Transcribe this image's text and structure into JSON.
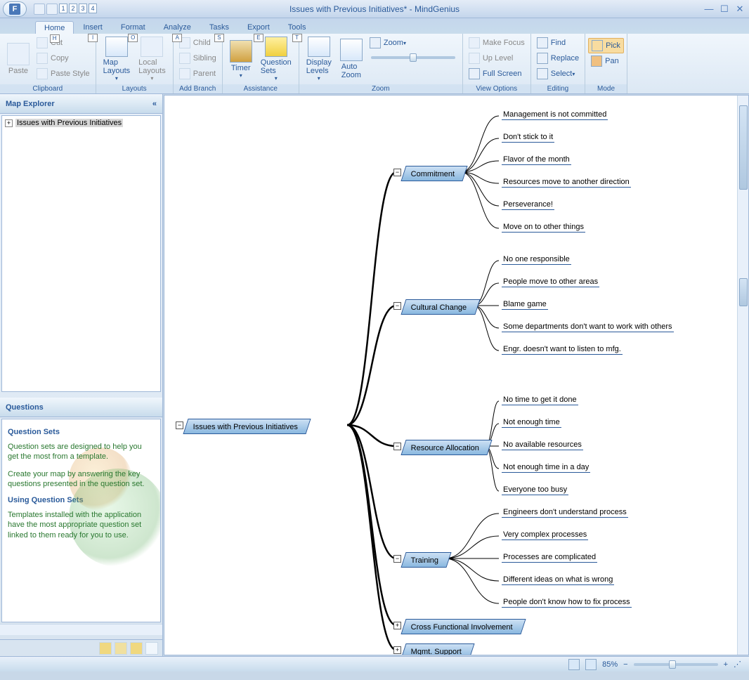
{
  "window": {
    "title": "Issues with Previous Initiatives* - MindGenius",
    "app_letter": "F"
  },
  "qat": {
    "nums": [
      "1",
      "2",
      "3",
      "4"
    ]
  },
  "tabs": [
    {
      "label": "Home",
      "key": "H",
      "active": true
    },
    {
      "label": "Insert",
      "key": "I",
      "active": false
    },
    {
      "label": "Format",
      "key": "O",
      "active": false
    },
    {
      "label": "Analyze",
      "key": "A",
      "active": false
    },
    {
      "label": "Tasks",
      "key": "S",
      "active": false
    },
    {
      "label": "Export",
      "key": "E",
      "active": false
    },
    {
      "label": "Tools",
      "key": "T",
      "active": false
    }
  ],
  "ribbon": {
    "clipboard": {
      "label": "Clipboard",
      "paste": "Paste",
      "cut": "Cut",
      "copy": "Copy",
      "paste_style": "Paste Style"
    },
    "layouts": {
      "label": "Layouts",
      "map": "Map\nLayouts",
      "local": "Local\nLayouts"
    },
    "addbranch": {
      "label": "Add Branch",
      "child": "Child",
      "sibling": "Sibling",
      "parent": "Parent"
    },
    "assistance": {
      "label": "Assistance",
      "timer": "Timer",
      "qsets": "Question\nSets"
    },
    "zoom": {
      "label": "Zoom",
      "levels": "Display\nLevels",
      "auto": "Auto\nZoom",
      "zoom": "Zoom"
    },
    "viewopts": {
      "label": "View Options",
      "focus": "Make Focus",
      "up": "Up Level",
      "full": "Full Screen"
    },
    "editing": {
      "label": "Editing",
      "find": "Find",
      "replace": "Replace",
      "select": "Select"
    },
    "mode": {
      "label": "Mode",
      "pick": "Pick",
      "pan": "Pan"
    }
  },
  "explorer": {
    "title": "Map Explorer",
    "root": "Issues with Previous Initiatives"
  },
  "questions": {
    "title": "Questions",
    "h1": "Question Sets",
    "p1": "Question sets are designed to help you get the most from a template.",
    "p2": "Create your map by answering the key questions presented in the question set.",
    "h2": "Using Question Sets",
    "p3": "Templates installed with the application have the most appropriate question set linked to them ready for you to use."
  },
  "map": {
    "root": "Issues with Previous Initiatives",
    "branches": [
      {
        "label": "Commitment",
        "leaves": [
          "Management is not committed",
          "Don't stick to it",
          "Flavor of the month",
          "Resources move to another direction",
          "Perseverance!",
          "Move on to other things"
        ]
      },
      {
        "label": "Cultural Change",
        "leaves": [
          "No one responsible",
          "People move to other areas",
          "Blame game",
          "Some departments don't want to work with others",
          "Engr. doesn't want to listen to mfg."
        ]
      },
      {
        "label": "Resource Allocation",
        "leaves": [
          "No time to get it done",
          "Not enough time",
          "No available resources",
          "Not enough time in a day",
          "Everyone too busy"
        ]
      },
      {
        "label": "Training",
        "leaves": [
          "Engineers don't understand process",
          "Very complex processes",
          "Processes are complicated",
          "Different ideas on what is wrong",
          "People don't know how to fix process"
        ]
      },
      {
        "label": "Cross Functional Involvement",
        "leaves": []
      },
      {
        "label": "Mgmt. Support",
        "leaves": []
      }
    ]
  },
  "status": {
    "zoom": "85%"
  }
}
